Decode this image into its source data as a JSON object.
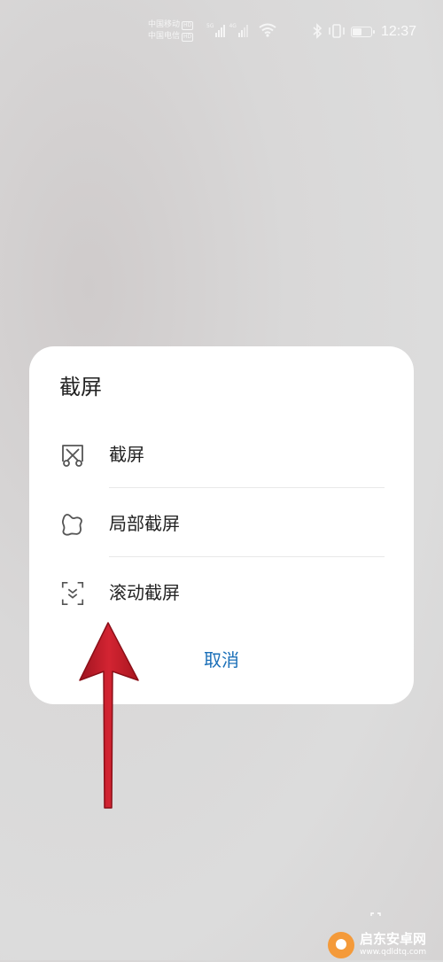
{
  "status_bar": {
    "carrier_1": "中国移动",
    "carrier_2": "中国电信",
    "hd_1": "HD",
    "hd_2": "HD",
    "net_1": "5G",
    "net_2": "4G",
    "time": "12:37",
    "icons": [
      "signal-icon",
      "wifi-icon",
      "bluetooth-icon",
      "vibrate-icon",
      "battery-icon"
    ],
    "battery_level": 0.55
  },
  "dialog": {
    "title": "截屏",
    "options": [
      {
        "label": "截屏",
        "icon": "screenshot-scissors-icon"
      },
      {
        "label": "局部截屏",
        "icon": "partial-screenshot-icon"
      },
      {
        "label": "滚动截屏",
        "icon": "scrolling-screenshot-icon"
      }
    ],
    "cancel_label": "取消"
  },
  "annotation": {
    "arrow_color": "#c8202e"
  },
  "watermark": {
    "text": "启东安卓网",
    "url": "www.qdldtq.com"
  },
  "colors": {
    "accent": "#1a6fb8",
    "dialog_bg": "#ffffff",
    "text": "#222222"
  }
}
